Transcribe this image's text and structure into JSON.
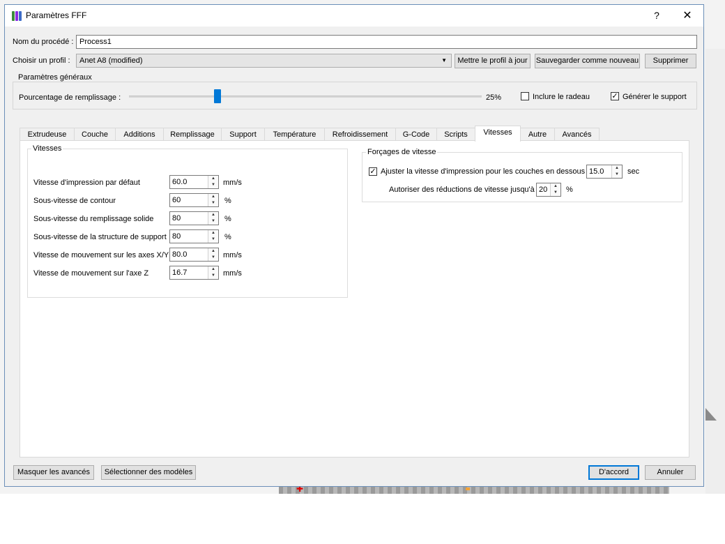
{
  "window": {
    "title": "Paramètres FFF",
    "help_glyph": "?",
    "close_glyph": "✕"
  },
  "header": {
    "process_label": "Nom du procédé :",
    "process_value": "Process1",
    "profile_label": "Choisir un profil :",
    "profile_value": "Anet A8 (modified)",
    "update_button": "Mettre le profil à jour",
    "save_new_button": "Sauvegarder comme nouveau",
    "delete_button": "Supprimer"
  },
  "general": {
    "group_title": "Paramètres généraux",
    "infill_label": "Pourcentage de remplissage :",
    "infill_value_text": "25%",
    "infill_fraction": 0.25,
    "raft_label": "Inclure le radeau",
    "raft_checked": false,
    "support_label": "Générer le support",
    "support_checked": true
  },
  "tabs": [
    {
      "label": "Extrudeuse"
    },
    {
      "label": "Couche"
    },
    {
      "label": "Additions"
    },
    {
      "label": "Remplissage"
    },
    {
      "label": "Support"
    },
    {
      "label": "Température"
    },
    {
      "label": "Refroidissement"
    },
    {
      "label": "G-Code"
    },
    {
      "label": "Scripts"
    },
    {
      "label": "Vitesses",
      "active": true
    },
    {
      "label": "Autre"
    },
    {
      "label": "Avancés"
    }
  ],
  "speeds": {
    "group_title": "Vitesses",
    "rows": [
      {
        "label": "Vitesse d'impression par défaut",
        "value": "60.0",
        "unit": "mm/s"
      },
      {
        "label": "Sous-vitesse de contour",
        "value": "60",
        "unit": "%"
      },
      {
        "label": "Sous-vitesse du remplissage solide",
        "value": "80",
        "unit": "%"
      },
      {
        "label": "Sous-vitesse de la structure de support",
        "value": "80",
        "unit": "%"
      },
      {
        "label": "Vitesse de mouvement sur les axes X/Y",
        "value": "80.0",
        "unit": "mm/s"
      },
      {
        "label": "Vitesse de mouvement sur l'axe Z",
        "value": "16.7",
        "unit": "mm/s"
      }
    ]
  },
  "overrides": {
    "group_title": "Forçages de vitesse",
    "adjust_label": "Ajuster la vitesse d'impression pour les couches en dessous",
    "adjust_checked": true,
    "adjust_value": "15.0",
    "adjust_unit": "sec",
    "reduction_label": "Autoriser des réductions de vitesse jusqu'à",
    "reduction_value": "20",
    "reduction_unit": "%"
  },
  "footer": {
    "hide_advanced_button": "Masquer les avancés",
    "select_models_button": "Sélectionner des modèles",
    "ok_button": "D'accord",
    "cancel_button": "Annuler"
  },
  "colors": {
    "accent": "#0078d7",
    "tab_active_bg": "#ffffff",
    "dialog_bg": "#f0f0f0"
  }
}
